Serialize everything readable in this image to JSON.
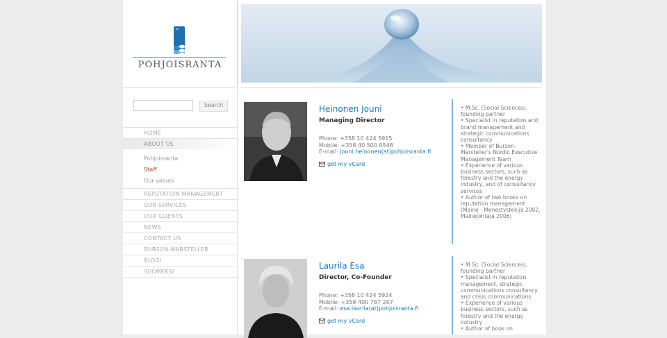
{
  "brand": {
    "name": "POHJOISRANTA",
    "accent": "#1a7ab5",
    "current_color": "#a9401b"
  },
  "search": {
    "value": "",
    "button_label": "Search"
  },
  "nav": {
    "items": [
      {
        "label": "HOME"
      },
      {
        "label": "ABOUT US"
      },
      {
        "label": "REPUTATION MANAGEMENT"
      },
      {
        "label": "OUR SERVICES"
      },
      {
        "label": "OUR CLIENTS"
      },
      {
        "label": "NEWS"
      },
      {
        "label": "CONTACT US"
      },
      {
        "label": "BURSON-MARSTELLER"
      },
      {
        "label": "BLOGI"
      },
      {
        "label": "SUOMEKSI"
      }
    ],
    "about_sub": [
      {
        "label": "Pohjoisranta"
      },
      {
        "label": "Staff"
      },
      {
        "label": "Our values"
      }
    ]
  },
  "profiles": [
    {
      "name": "Heinonen Jouni",
      "title": "Managing Director",
      "phone": "Phone: +358 10 424 5915",
      "mobile": "Mobile: +358 40 500 0548",
      "email_label": "E-mail: ",
      "email": "jouni.heinonen(at)pohjoisranta.fi",
      "vcard_label": "get my vCard",
      "bio": [
        "• M.Sc. (Social Sciences), founding partner",
        "• Specialist in reputation and brand management and strategic communications consultancy",
        "• Member of Burson-Marsteller's Nordic Executive Management Team",
        "• Experience of various business sectors, such as forestry and the energy industry, and of consultancy services",
        "• Author of two books on reputation management (Maine - Menestystekijä 2002, Mainejohtaja 2006)"
      ]
    },
    {
      "name": "Laurila Esa",
      "title": "Director, Co-Founder",
      "phone": "Phone: +358 10 424 5924",
      "mobile": "Mobile: +358 400 787 207",
      "email_label": "E-mail: ",
      "email": "esa.laurila(at)pohjoisranta.fi",
      "vcard_label": "get my vCard",
      "bio": [
        "• M.Sc. (Social Sciences), founding partner",
        "• Specialist in reputation management, strategic communications consultancy and crisis communications",
        "• Experience of various business sectors, such as forestry and the energy industry",
        "• Author of book on"
      ]
    }
  ]
}
